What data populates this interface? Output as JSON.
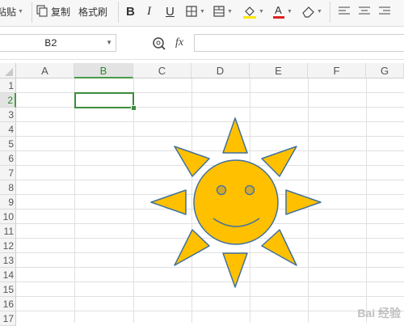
{
  "toolbar": {
    "paste_label": "粘贴",
    "copy_label": "复制",
    "format_painter_label": "格式刷",
    "bold_label": "B",
    "italic_label": "I",
    "underline_label": "U"
  },
  "formula_bar": {
    "name_box_value": "B2",
    "fx_label": "fx",
    "formula_value": ""
  },
  "grid": {
    "columns": [
      "A",
      "B",
      "C",
      "D",
      "E",
      "F",
      "G"
    ],
    "selected_column": "B",
    "rows": [
      "1",
      "2",
      "3",
      "4",
      "5",
      "6",
      "7",
      "8",
      "9",
      "10",
      "11",
      "12",
      "13",
      "14",
      "15",
      "16",
      "17"
    ],
    "selected_row": "2",
    "active_cell": "B2"
  },
  "shape": {
    "name": "sun-smiley",
    "fill_color": "#FFC000",
    "outline_color": "#41719C"
  },
  "colors": {
    "selection_green": "#3c8c3c",
    "font_color_bar": "#e02020",
    "highlight_bar": "#ffe600"
  },
  "watermark": "Bai 经验"
}
